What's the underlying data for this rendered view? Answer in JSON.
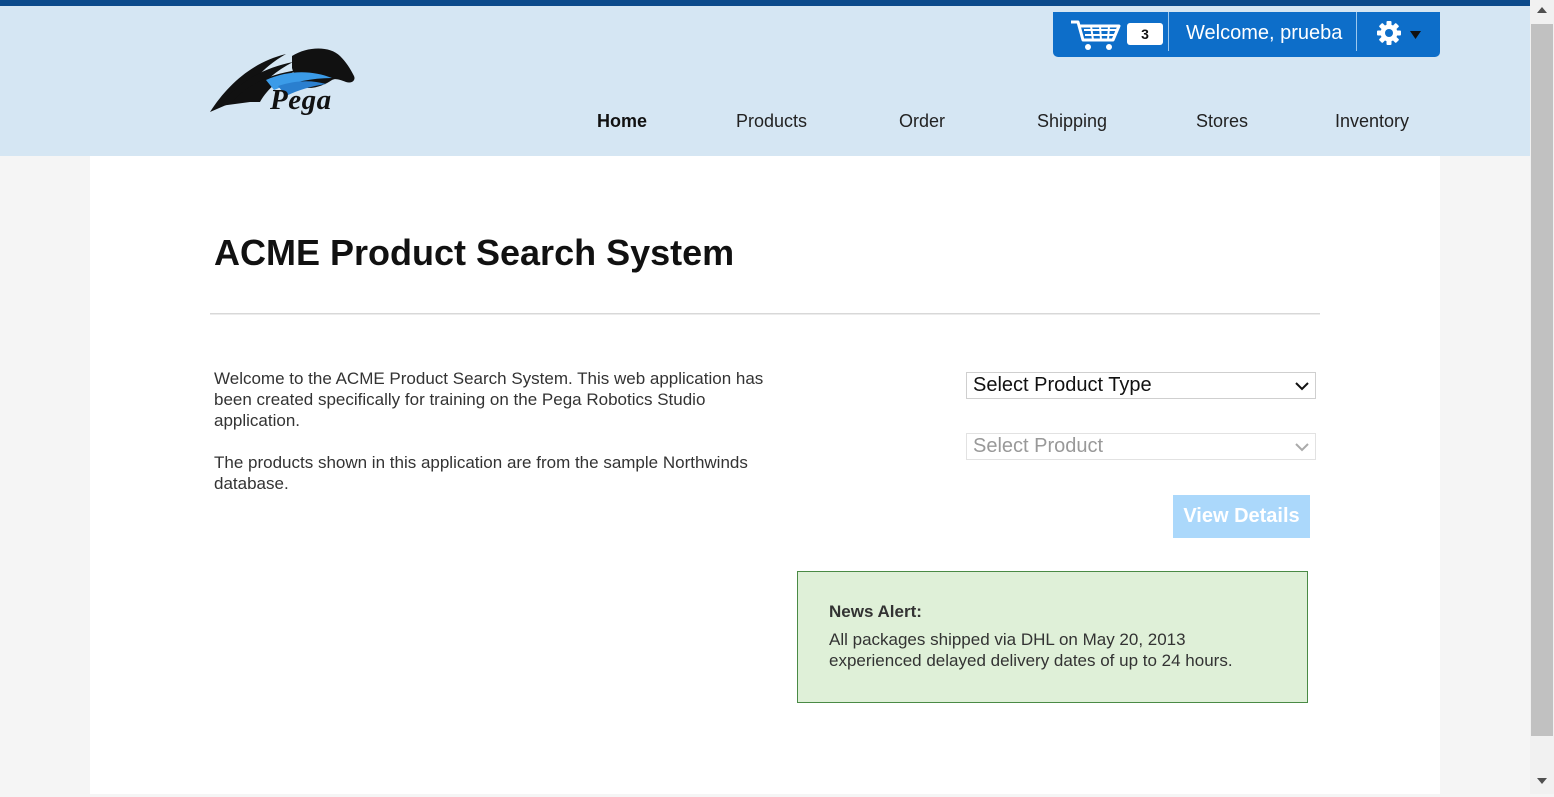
{
  "header": {
    "logo_text": "Pega",
    "cart_count": "3",
    "welcome": "Welcome, prueba"
  },
  "nav": [
    {
      "label": "Home",
      "active": true
    },
    {
      "label": "Products"
    },
    {
      "label": "Order"
    },
    {
      "label": "Shipping"
    },
    {
      "label": "Stores"
    },
    {
      "label": "Inventory"
    }
  ],
  "main": {
    "title": "ACME Product Search System",
    "intro_p1": "Welcome to the ACME Product Search System. This web application has been created specifically for training on the Pega Robotics Studio application.",
    "intro_p2": "The products shown in this application are from the sample Northwinds database.",
    "select_type": "Select Product Type",
    "select_product": "Select Product",
    "view_details": "View Details",
    "news_title": "News Alert:",
    "news_body": "All packages shipped via DHL on May 20, 2013 experienced delayed delivery dates of up to 24 hours."
  },
  "icons": {
    "cart": "shopping-cart-icon",
    "gear": "gear-icon",
    "caret": "caret-down-icon",
    "chevron": "chevron-down-icon"
  },
  "colors": {
    "topbar": "#0b4a8b",
    "header_bg": "#d5e6f3",
    "userbar_bg": "#0d6ec9",
    "button_disabled": "#abd8fb",
    "news_bg": "#dff0d8",
    "news_border": "#4a8a45"
  }
}
